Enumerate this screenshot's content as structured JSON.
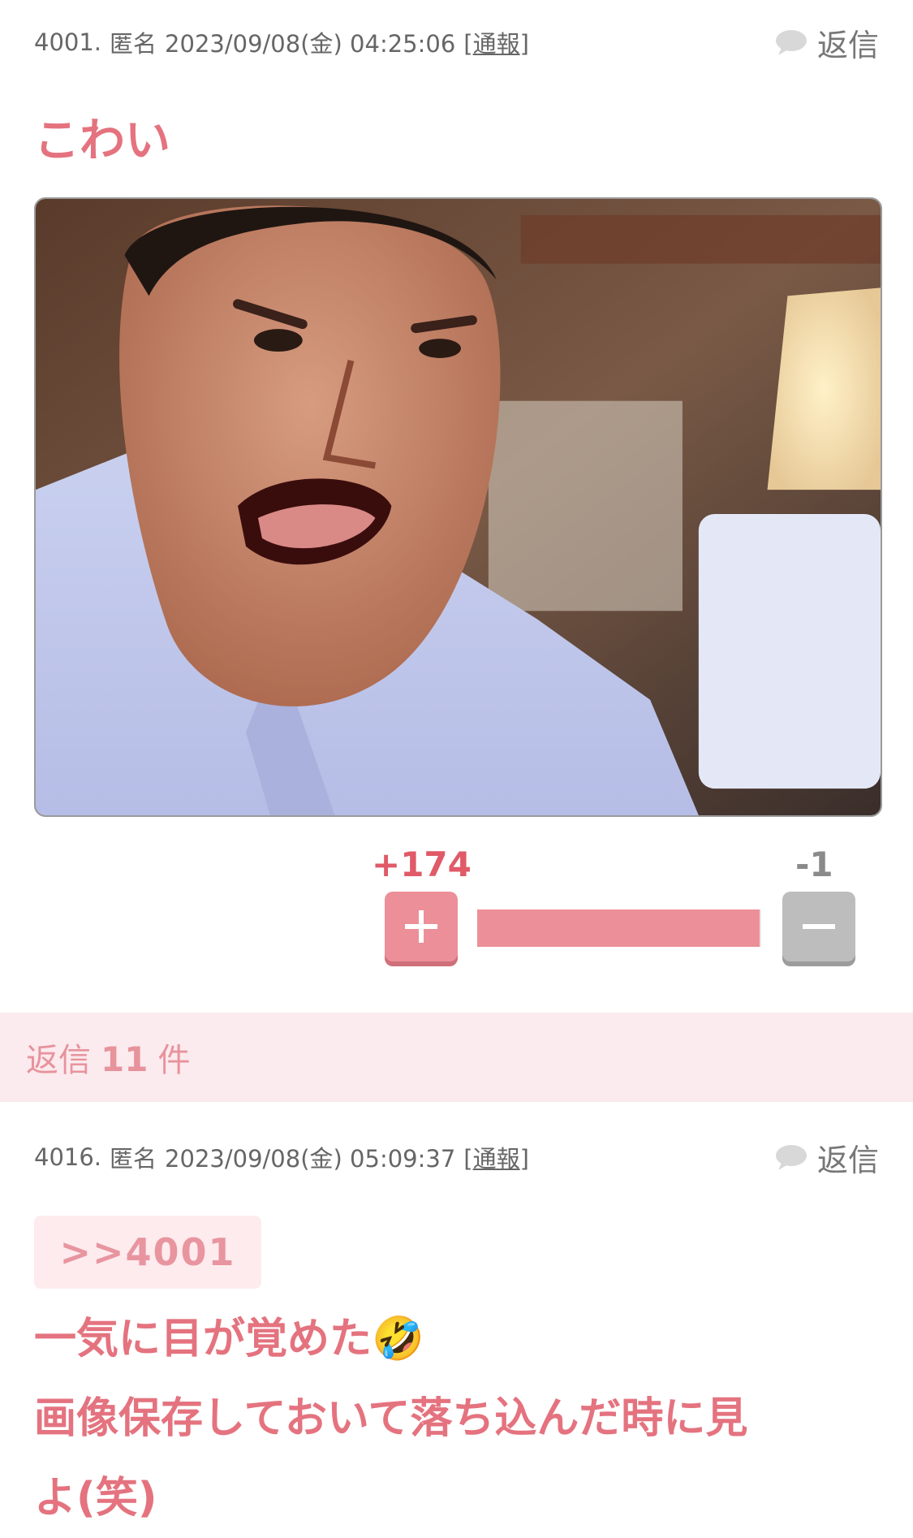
{
  "post": {
    "number": "4001.",
    "author": "匿名",
    "datetime": "2023/09/08(金) 04:25:06",
    "report_label": "通報",
    "reply_label": "返信",
    "title": "こわい",
    "votes": {
      "plus": "+174",
      "minus": "-1",
      "plus_ratio": 0.994
    }
  },
  "replies_band": {
    "prefix": "返信",
    "count": "11",
    "suffix": "件"
  },
  "reply": {
    "number": "4016.",
    "author": "匿名",
    "datetime": "2023/09/08(金) 05:09:37",
    "report_label": "通報",
    "reply_label": "返信",
    "anchor": ">>4001",
    "lines": [
      "一気に目が覚めた🤣",
      "画像保存しておいて落ち込んだ時に見",
      "よ(笑)"
    ]
  },
  "colors": {
    "accent": "#e4737f",
    "plus": "#ec8f98",
    "minus": "#bdbdbd",
    "band": "#fbeaee"
  }
}
